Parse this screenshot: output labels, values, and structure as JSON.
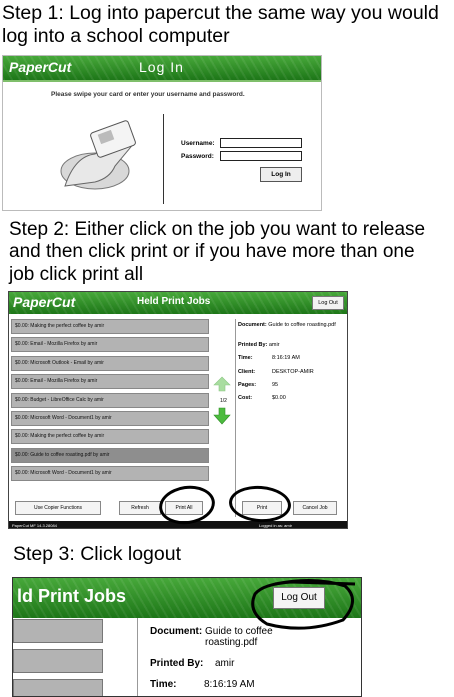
{
  "steps": {
    "step1": "Step 1: Log into papercut the same way you would log into a school computer",
    "step2": "Step 2: Either click on the job you want to release  and then click print or if you have more than one job click print all",
    "step3": "Step 3: Click logout"
  },
  "login": {
    "logo": "PaperCut",
    "title": "Log In",
    "prompt": "Please swipe your card or enter your username and password.",
    "username_label": "Username:",
    "password_label": "Password:",
    "login_button": "Log In"
  },
  "held": {
    "logo": "PaperCut",
    "title": "Held Print Jobs",
    "logout_button": "Log Out",
    "jobs": [
      "$0.00: Making the perfect coffee by amir",
      "$0.00: Email - Mozilla Firefox by amir",
      "$0.00: Microsoft Outlook - Email by amir",
      "$0.00: Email - Mozilla Firefox by amir",
      "$0.00: Budget - LibreOffice Calc by amir",
      "$0.00: Microsoft Word - Document1 by amir",
      "$0.00: Making the perfect coffee by amir",
      "$0.00: Guide to coffee roasting.pdf by amir",
      "$0.00: Microsoft Word - Document1 by amir"
    ],
    "selected_index": 7,
    "pager": "1/2",
    "details": {
      "document_label": "Document:",
      "document_value": "Guide to coffee roasting.pdf",
      "printed_by_label": "Printed By:",
      "printed_by_value": "amir",
      "time_label": "Time:",
      "time_value": "8:16:19 AM",
      "client_label": "Client:",
      "client_value": "DESKTOP-AMIR",
      "pages_label": "Pages:",
      "pages_value": "95",
      "cost_label": "Cost:",
      "cost_value": "$0.00"
    },
    "buttons": {
      "copier": "Use Copier Functions",
      "refresh": "Refresh",
      "print_all": "Print All",
      "print": "Print",
      "cancel_job": "Cancel Job"
    },
    "footer_left": "PaperCut MF 14.3.28084",
    "footer_right": "Logged in as: amir"
  },
  "zoom": {
    "title": "ld Print Jobs",
    "logout_button": "Log Out",
    "document_label": "Document:",
    "document_value": "Guide to coffee roasting.pdf",
    "printed_by_label": "Printed By:",
    "printed_by_value": "amir",
    "time_label": "Time:",
    "time_value": "8:16:19 AM"
  },
  "colors": {
    "header_green": "#2e8f25",
    "job_gray": "#b3b3b3",
    "arrow_green": "#4dbb3f"
  }
}
